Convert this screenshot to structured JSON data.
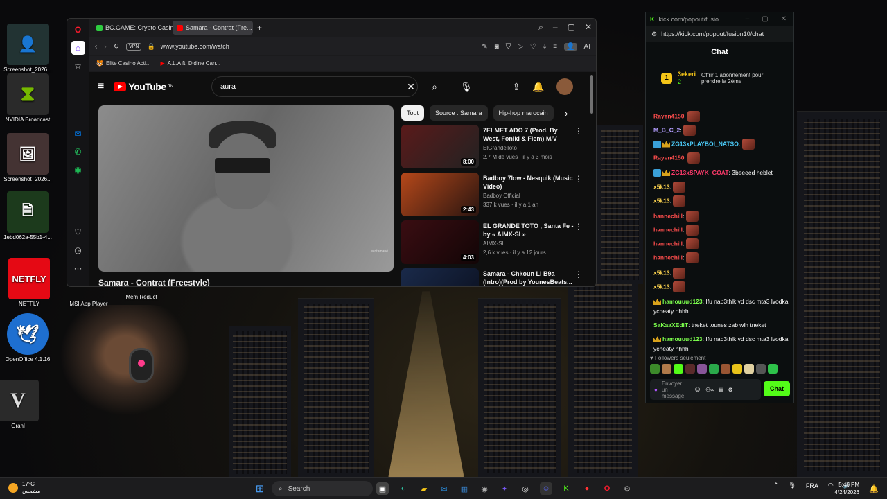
{
  "desktop": {
    "icons": [
      {
        "label": "Screenshot_2026...",
        "glyph": "👤"
      },
      {
        "label": "NVIDIA Broadcast",
        "glyph": "⧗"
      },
      {
        "label": "Screenshot_2026...",
        "glyph": "🖼"
      },
      {
        "label": "1ebd062a-55b1-4...",
        "glyph": "🗎"
      },
      {
        "label": "NETFLY",
        "glyph": "NETFLY"
      },
      {
        "label": "OpenOffice 4.1.16",
        "glyph": "🕊"
      },
      {
        "label": "Granl",
        "glyph": "V"
      },
      {
        "label": "MSI App Player",
        "glyph": ""
      },
      {
        "label": "Mem Reduct",
        "glyph": ""
      }
    ]
  },
  "browser": {
    "tabs": [
      {
        "label": "BC.GAME: Crypto Casino ...",
        "color": "#2ecc40"
      },
      {
        "label": "Samara - Contrat (Fre...",
        "color": "#ff0000"
      }
    ],
    "new_tab": "+",
    "url": "www.youtube.com/watch",
    "vpn": "VPN",
    "ai": "AI",
    "bookmarks": [
      {
        "label": "Elite Casino Acti...",
        "glyph": "🐯"
      },
      {
        "label": "A.L.A ft. Didine Can...",
        "glyph": "▶"
      }
    ],
    "window_controls": {
      "search": "⌕",
      "minimize": "–",
      "maximize": "▢",
      "close": "✕"
    }
  },
  "youtube": {
    "logo": "YouTube",
    "logo_sup": "TN",
    "search_value": "aura",
    "video_title": "Samara - Contrat (Freestyle)",
    "video_watermark": "ecotamané",
    "chips": [
      "Tout",
      "Source : Samara",
      "Hip-hop marocain"
    ],
    "recommendations": [
      {
        "title": "7ELMET ADO 7 (Prod. By West, Foniki & Flem) M/V",
        "channel": "ElGrandeToto",
        "meta": "2,7 M de vues · il y a 3 mois",
        "duration": "8:00",
        "thumb": "#5a1a1a"
      },
      {
        "title": "Badboy 7low - Nesquik (Music Video)",
        "channel": "Badboy Official",
        "meta": "337 k vues · il y a 1 an",
        "duration": "2:43",
        "thumb": "#b5481a"
      },
      {
        "title": "EL GRANDE TOTO , Santa Fe - by « AIMX-SI »",
        "channel": "AIMX-SI",
        "meta": "2,6 k vues · il y a 12 jours",
        "duration": "4:03",
        "thumb": "#3a0d12"
      },
      {
        "title": "Samara - Chkoun Li B9a (Intro)(Prod by YounesBeats...",
        "channel": "",
        "meta": "",
        "duration": "",
        "thumb": "#1a2a4a"
      }
    ]
  },
  "kick": {
    "popup_title": "kick.com/popout/fusio...",
    "url": "https://kick.com/popout/fusion10/chat",
    "chat_header": "Chat",
    "pinned": {
      "rank": "1",
      "user": "3ekeri",
      "count": "2",
      "text": "Offrir 1 abonnement pour prendre la 2ème"
    },
    "messages": [
      {
        "user": "Rayen4150",
        "color": "#ff4d4d",
        "text": ""
      },
      {
        "user": "M_B_C_2",
        "color": "#b39dff",
        "text": ""
      },
      {
        "user": "ZG13xPLAYBOI_NATSO",
        "color": "#4dd0ff",
        "text": ""
      },
      {
        "user": "Rayen4150",
        "color": "#ff4d4d",
        "text": ""
      },
      {
        "user": "ZG13xSPAYK_GOAT",
        "color": "#ff3b6b",
        "text": "3beeeed heblet"
      },
      {
        "user": "x5k13",
        "color": "#ffd54f",
        "text": ""
      },
      {
        "user": "x5k13",
        "color": "#ffd54f",
        "text": ""
      },
      {
        "user": "hannechill",
        "color": "#ff4d4d",
        "text": ""
      },
      {
        "user": "hannechill",
        "color": "#ff4d4d",
        "text": ""
      },
      {
        "user": "hannechill",
        "color": "#ff4d4d",
        "text": ""
      },
      {
        "user": "hannechill",
        "color": "#ff4d4d",
        "text": ""
      },
      {
        "user": "x5k13",
        "color": "#ffd54f",
        "text": ""
      },
      {
        "user": "x5k13",
        "color": "#ffd54f",
        "text": ""
      },
      {
        "user": "hamouuud123",
        "color": "#7cff4d",
        "text": "Ifu nab3thlk vd dsc mta3 lvodka ycheaty hhhh"
      },
      {
        "user": "SaKaaXEdiT",
        "color": "#7cff4d",
        "text": "tneket tounes zab wlh tneket"
      },
      {
        "user": "hamouuud123",
        "color": "#7cff4d",
        "text": "Ifu nab3thlk vd dsc mta3 lvodka ycheaty hhhh"
      }
    ],
    "followers_only": "Followers seulement",
    "input_placeholder": "Envoyer un message",
    "send_label": "Chat"
  },
  "taskbar": {
    "temp": "17°C",
    "condition": "مشمس",
    "search_placeholder": "Search",
    "lang": "FRA",
    "time": "5:46 PM",
    "date": "4/24/2026"
  }
}
